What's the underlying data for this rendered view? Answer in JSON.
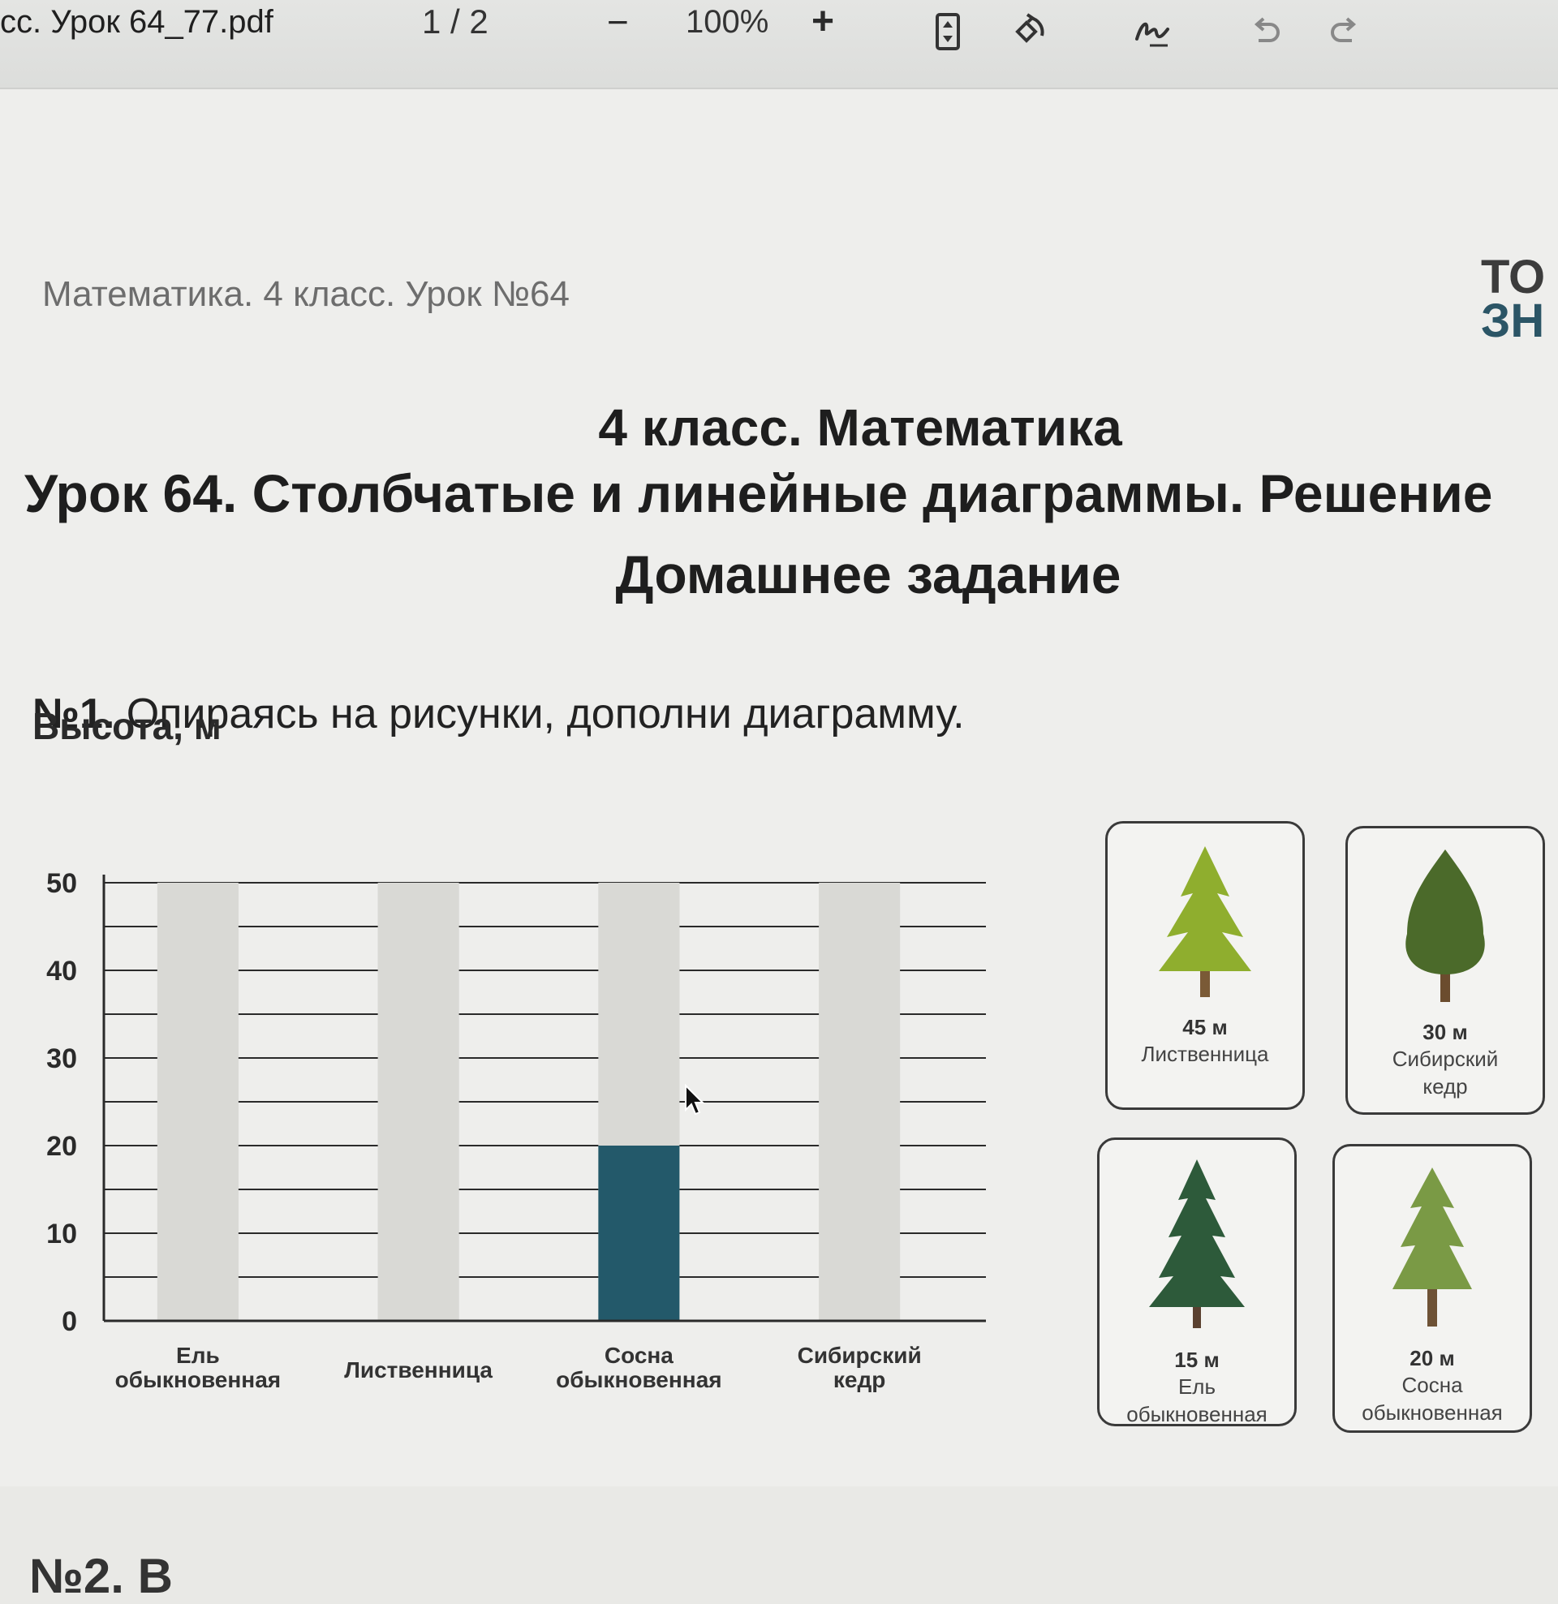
{
  "toolbar": {
    "filename": "сс. Урок 64_77.pdf",
    "page_indicator": "1 / 2",
    "zoom_out": "−",
    "zoom": "100%",
    "zoom_in": "+",
    "icons": [
      "fit-page-icon",
      "rotate-icon",
      "signature-icon",
      "undo-icon",
      "redo-icon"
    ]
  },
  "document": {
    "header": "Математика. 4 класс. Урок №64",
    "logo_line1": "ТО",
    "logo_line2": "ЗН",
    "title_line1": "4 класс. Математика",
    "title_line2": "Урок 64. Столбчатые и линейные диаграммы. Решение",
    "title_line3": "Домашнее задание",
    "task_number": "№1.",
    "task_text": " Опираясь на рисунки, дополни диаграмму.",
    "bottom_cut": "№2. В"
  },
  "chart_data": {
    "type": "bar",
    "ylabel": "Высота, м",
    "ylim": [
      0,
      50
    ],
    "yticks": [
      0,
      10,
      20,
      30,
      40,
      50
    ],
    "categories": [
      [
        "Ель",
        "обыкновенная"
      ],
      [
        "Лиственница"
      ],
      [
        "Сосна",
        "обыкновенная"
      ],
      [
        "Сибирский",
        "кедр"
      ]
    ],
    "values": [
      null,
      null,
      20,
      null
    ],
    "filled_color": "#23596a",
    "empty_color": "#d9d9d5"
  },
  "cards": [
    {
      "height": "45 м",
      "name": [
        "Лиственница"
      ],
      "color": "#8fae2e"
    },
    {
      "height": "30 м",
      "name": [
        "Сибирский",
        "кедр"
      ],
      "color": "#4b6a2a"
    },
    {
      "height": "15 м",
      "name": [
        "Ель",
        "обыкновенная"
      ],
      "color": "#2d5a3a"
    },
    {
      "height": "20 м",
      "name": [
        "Сосна",
        "обыкновенная"
      ],
      "color": "#7a9a45"
    }
  ]
}
